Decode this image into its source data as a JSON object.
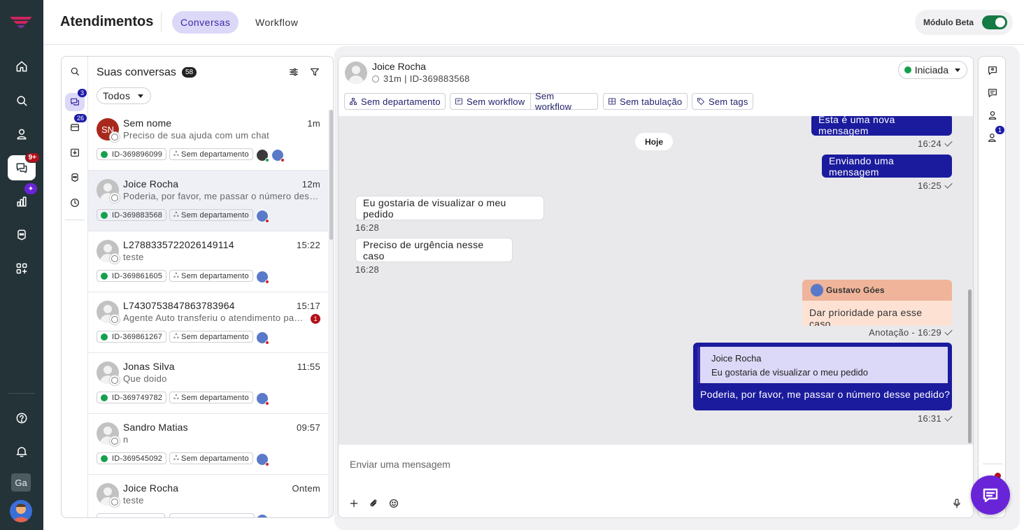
{
  "header": {
    "title": "Atendimentos",
    "tabs": [
      {
        "label": "Conversas",
        "active": true
      },
      {
        "label": "Workflow",
        "active": false
      }
    ],
    "beta_label": "Módulo Beta",
    "beta_enabled": true
  },
  "rail": {
    "items": [
      {
        "icon": "home-icon"
      },
      {
        "icon": "search-icon"
      },
      {
        "icon": "user-icon"
      },
      {
        "icon": "chat-icon",
        "badge": "9+",
        "active": true
      },
      {
        "icon": "chart-icon",
        "badge_icon": "sparkle-icon"
      },
      {
        "icon": "bot-icon"
      },
      {
        "icon": "apps-icon"
      }
    ],
    "bottom": {
      "help_icon": "help-icon",
      "bell_icon": "bell-icon",
      "workspace": "Ga",
      "avatar": "user-avatar"
    }
  },
  "filters": {
    "inbox_badge": "3",
    "queue_badge": "26"
  },
  "conversations": {
    "title": "Suas conversas",
    "count": "58",
    "filter_select": "Todos",
    "items": [
      {
        "name": "Sem nome",
        "initials": "SN",
        "time": "1m",
        "preview": "Preciso de sua ajuda com um chat",
        "id": "ID-369896099",
        "department": "Sem departamento",
        "unread": ""
      },
      {
        "name": "Joice Rocha",
        "time": "12m",
        "preview": "Poderia, por favor, me passar o número desse pedido?",
        "id": "ID-369883568",
        "department": "Sem departamento",
        "unread": ""
      },
      {
        "name": "L2788335722026149114",
        "time": "15:22",
        "preview": "teste",
        "id": "ID-369861605",
        "department": "Sem departamento",
        "unread": ""
      },
      {
        "name": "L7430753847863783964",
        "time": "15:17",
        "preview": "Agente Auto transferiu o atendimento para outro agente",
        "id": "ID-369861267",
        "department": "Sem departamento",
        "unread": "1"
      },
      {
        "name": "Jonas Silva",
        "time": "11:55",
        "preview": "Que doido",
        "id": "ID-369749782",
        "department": "Sem departamento",
        "unread": ""
      },
      {
        "name": "Sandro Matias",
        "time": "09:57",
        "preview": "n",
        "id": "ID-369545092",
        "department": "Sem departamento",
        "unread": ""
      },
      {
        "name": "Joice Rocha",
        "time": "Ontem",
        "preview": "teste",
        "id": "",
        "department": "",
        "unread": ""
      }
    ]
  },
  "chat": {
    "contact_name": "Joice Rocha",
    "subtitle": "31m | ID-369883568",
    "status": "Iniciada",
    "chips": [
      "Sem departamento",
      "Sem workflow",
      "Sem workflow",
      "Sem tabulação",
      "Sem tags"
    ],
    "date_separator": "Hoje",
    "messages": [
      {
        "dir": "out",
        "text": "Esta é uma nova mensagem",
        "time": "16:24"
      },
      {
        "dir": "out",
        "text": "Enviando uma mensagem",
        "time": "16:25"
      },
      {
        "dir": "in",
        "text": "Eu gostaria de visualizar o meu pedido",
        "time": "16:28"
      },
      {
        "dir": "in",
        "text": "Preciso de urgência nesse caso",
        "time": "16:28"
      }
    ],
    "note": {
      "author": "Gustavo Góes",
      "text": "Dar prioridade para esse caso",
      "time": "Anotação - 16:29"
    },
    "reply": {
      "quoted_name": "Joice Rocha",
      "quoted_text": "Eu gostaria de visualizar o meu pedido",
      "text": "Poderia, por favor, me passar o número desse pedido?",
      "time": "16:31"
    },
    "composer_placeholder": "Enviar uma mensagem"
  },
  "right_rail": {
    "badge": "1"
  },
  "colors": {
    "rail": "#243338",
    "accent": "#1b1b9e",
    "active_tab": "#dcd8f7",
    "online": "#14a04d",
    "fab": "#6a24d8"
  }
}
